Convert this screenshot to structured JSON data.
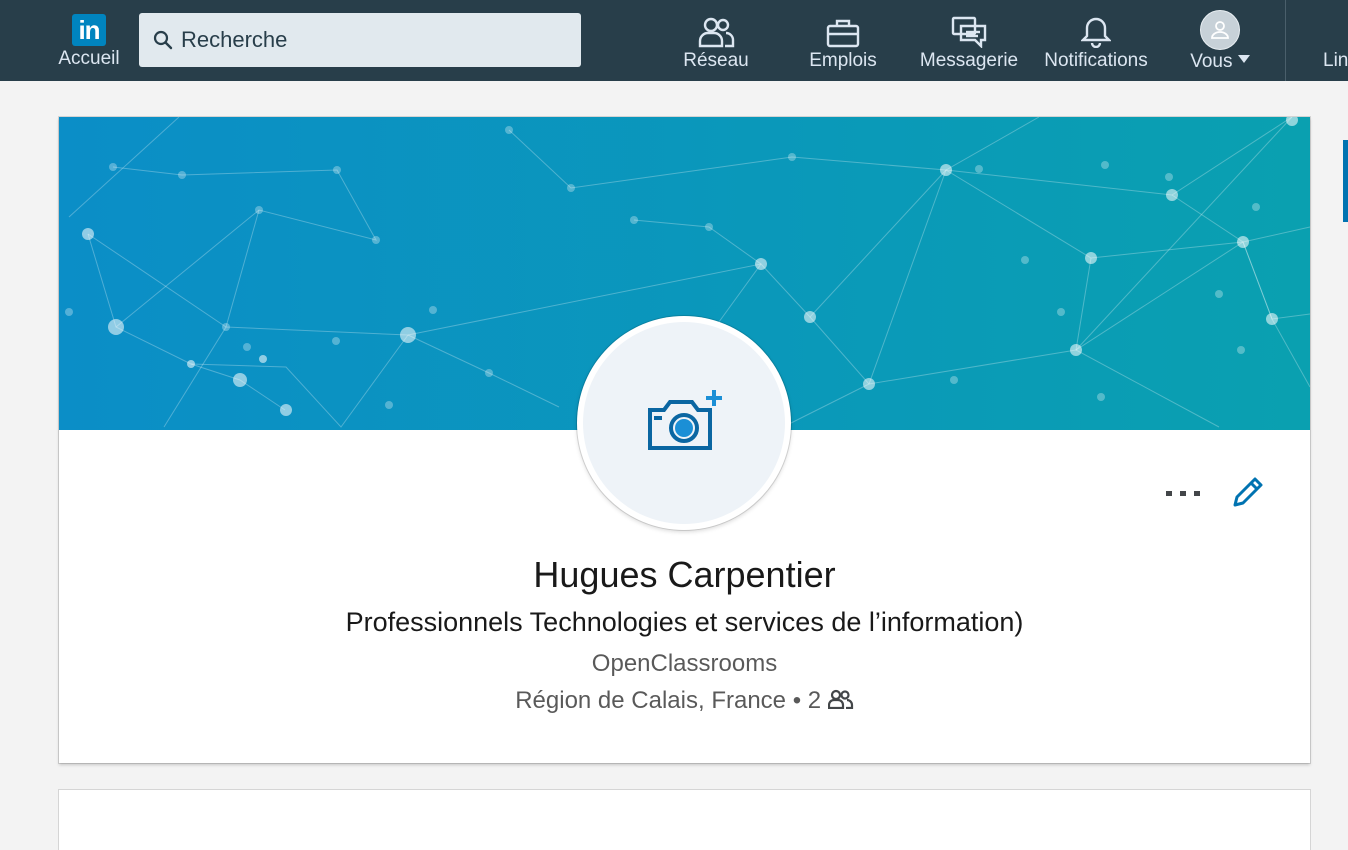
{
  "nav": {
    "home_label": "Accueil",
    "logo_text": "in",
    "search_placeholder": "Recherche",
    "network_label": "Réseau",
    "jobs_label": "Emplois",
    "messaging_label": "Messagerie",
    "notifications_label": "Notifications",
    "me_label": "Vous",
    "cut_label": "Lin"
  },
  "profile": {
    "name": "Hugues Carpentier",
    "headline": "Professionnels Technologies et services de l’information)",
    "company": "OpenClassrooms",
    "location": "Région de Calais, France",
    "separator": "•",
    "connections": "2"
  },
  "icons": {
    "photo": "camera-plus-icon",
    "more": "ellipsis-icon",
    "edit": "pencil-icon",
    "connections": "people-icon"
  },
  "colors": {
    "nav_bg": "#283e4a",
    "accent": "#0073b1",
    "banner_start": "#0b8ec7",
    "banner_end": "#0aa0b0"
  }
}
